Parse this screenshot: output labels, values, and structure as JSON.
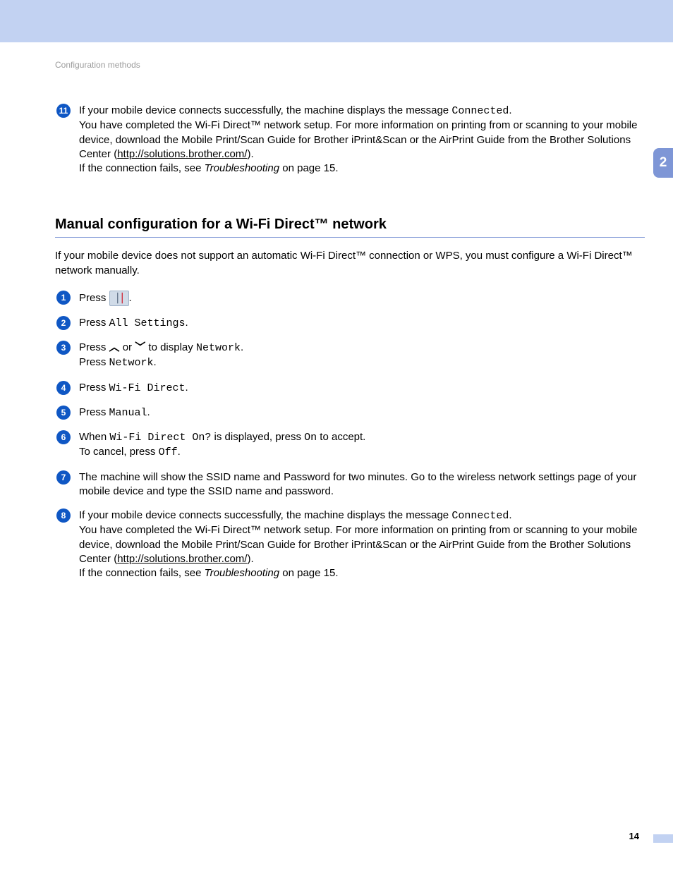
{
  "header": {
    "breadcrumb": "Configuration methods"
  },
  "chapter": {
    "number": "2"
  },
  "messages": {
    "connected": "Connected"
  },
  "labels": {
    "all_settings": "All Settings",
    "network": "Network",
    "wifi_direct": "Wi-Fi Direct",
    "manual": "Manual",
    "wifi_direct_on_q": "Wi-Fi Direct On?",
    "on": "On",
    "off": "Off"
  },
  "step11": {
    "line1a": "If your mobile device connects successfully, the machine displays the message ",
    "line1b": ".",
    "line2": "You have completed the Wi-Fi Direct™ network setup. For more information on printing from or scanning to your mobile device, download the Mobile Print/Scan Guide for Brother iPrint&Scan or the AirPrint Guide from the Brother Solutions Center (",
    "link": "http://solutions.brother.com/",
    "line2b": ").",
    "line3a": "If the connection fails, see ",
    "line3_em": "Troubleshooting",
    "line3b": " on page 15."
  },
  "section": {
    "heading": "Manual configuration for a Wi-Fi Direct™ network",
    "intro": "If your mobile device does not support an automatic Wi-Fi Direct™ connection or WPS, you must configure a Wi-Fi Direct™ network manually."
  },
  "steps": {
    "s1": {
      "pre": "Press ",
      "post": "."
    },
    "s2": {
      "pre": "Press ",
      "post": "."
    },
    "s3": {
      "a": "Press ",
      "b": " or ",
      "c": " to display ",
      "d": ".",
      "l2a": "Press ",
      "l2b": "."
    },
    "s4": {
      "pre": "Press ",
      "post": "."
    },
    "s5": {
      "pre": "Press ",
      "post": "."
    },
    "s6": {
      "a": "When ",
      "b": " is displayed, press ",
      "c": " to accept.",
      "l2a": "To cancel, press ",
      "l2b": "."
    },
    "s7": "The machine will show the SSID name and Password for two minutes. Go to the wireless network settings page of your mobile device and type the SSID name and password.",
    "s8": {
      "line1a": "If your mobile device connects successfully, the machine displays the message ",
      "line1b": ".",
      "line2": "You have completed the Wi-Fi Direct™ network setup. For more information on printing from or scanning to your mobile device, download the Mobile Print/Scan Guide for Brother iPrint&Scan or the AirPrint Guide from the Brother Solutions Center (",
      "link": "http://solutions.brother.com/",
      "line2b": ").",
      "line3a": "If the connection fails, see ",
      "line3_em": "Troubleshooting",
      "line3b": " on page 15."
    }
  },
  "footer": {
    "page": "14"
  },
  "bullets": {
    "n11": "11",
    "n1": "1",
    "n2": "2",
    "n3": "3",
    "n4": "4",
    "n5": "5",
    "n6": "6",
    "n7": "7",
    "n8": "8"
  }
}
